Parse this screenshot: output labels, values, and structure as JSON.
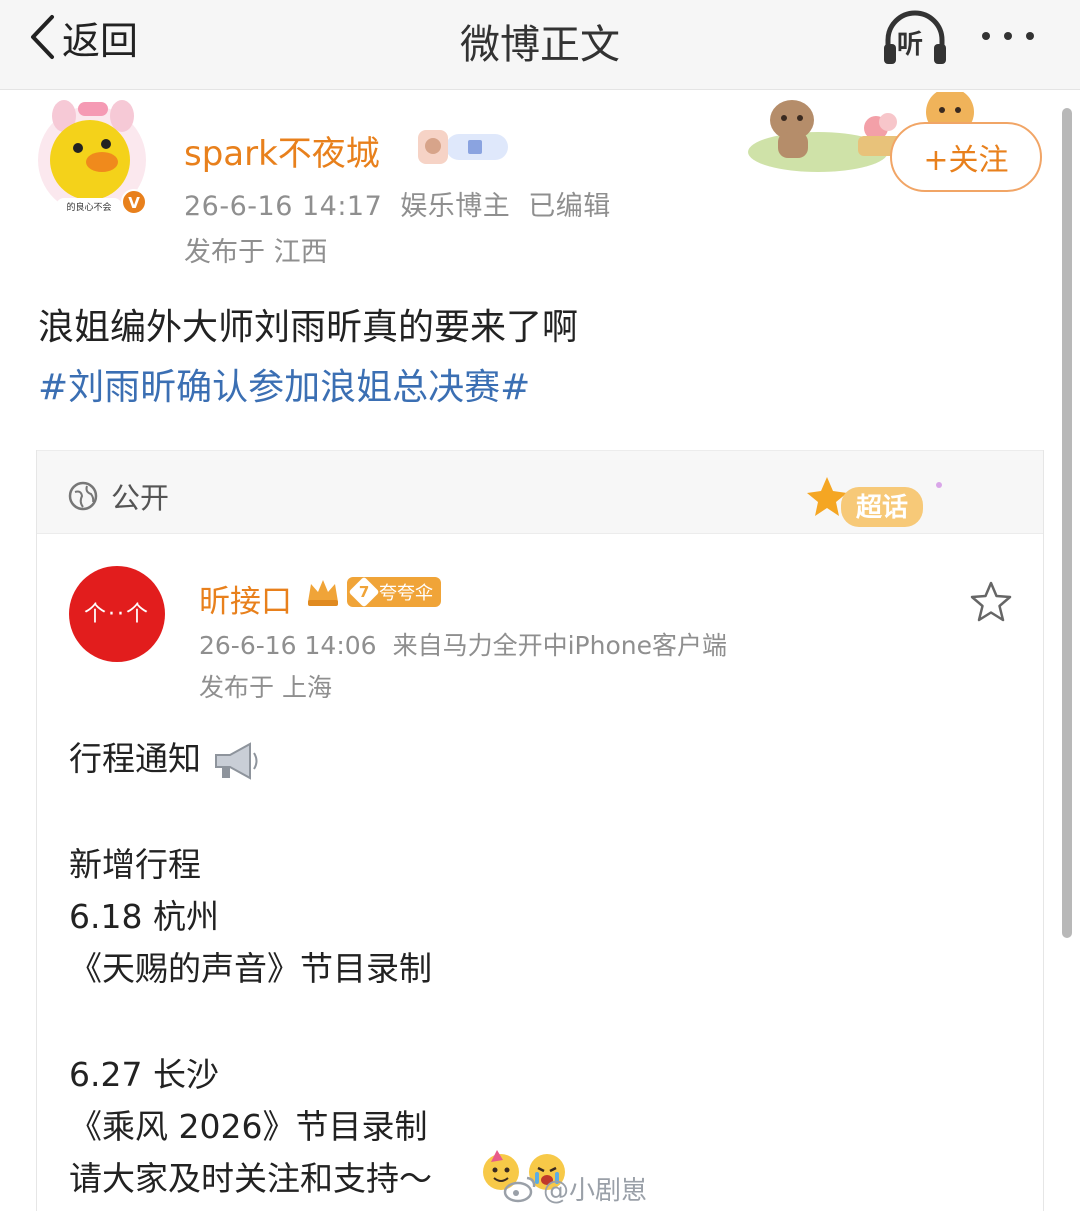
{
  "nav": {
    "back_label": "返回",
    "title": "微博正文",
    "listen_label": "听"
  },
  "post": {
    "user": "spark不夜城",
    "avatar_caption": "的良心不会",
    "verified_mark": "V",
    "follow_label": "+关注",
    "time": "26-6-16 14:17",
    "role": "娱乐博主",
    "edited": "已编辑",
    "location": "发布于 江西",
    "text": "浪姐编外大师刘雨昕真的要来了啊",
    "topic": "#刘雨昕确认参加浪姐总决赛#"
  },
  "card": {
    "visibility": "公开",
    "supertopic_label": "超话",
    "user": "昕接口",
    "badge_level": "7",
    "badge_text": "夸夸伞",
    "avatar_text": "个··个",
    "time": "26-6-16 14:06",
    "source": "来自马力全开中iPhone客户端",
    "location": "发布于 上海",
    "lines": [
      "行程通知",
      "新增行程",
      "6.18 杭州",
      "《天赐的声音》节目录制",
      "6.27 长沙",
      "《乘风 2026》节目录制",
      "请大家及时关注和支持～"
    ]
  },
  "watermark": "@小剧崽",
  "colors": {
    "username": "#e8801c",
    "topic_link": "#3b6fb3",
    "meta_gray": "#8f8f8f",
    "card_avatar_red": "#e21d1d"
  },
  "icons": [
    "back-chevron-icon",
    "headphones-icon",
    "more-dots-icon",
    "globe-icon",
    "star-icon",
    "megaphone-icon",
    "weibo-logo-icon"
  ]
}
